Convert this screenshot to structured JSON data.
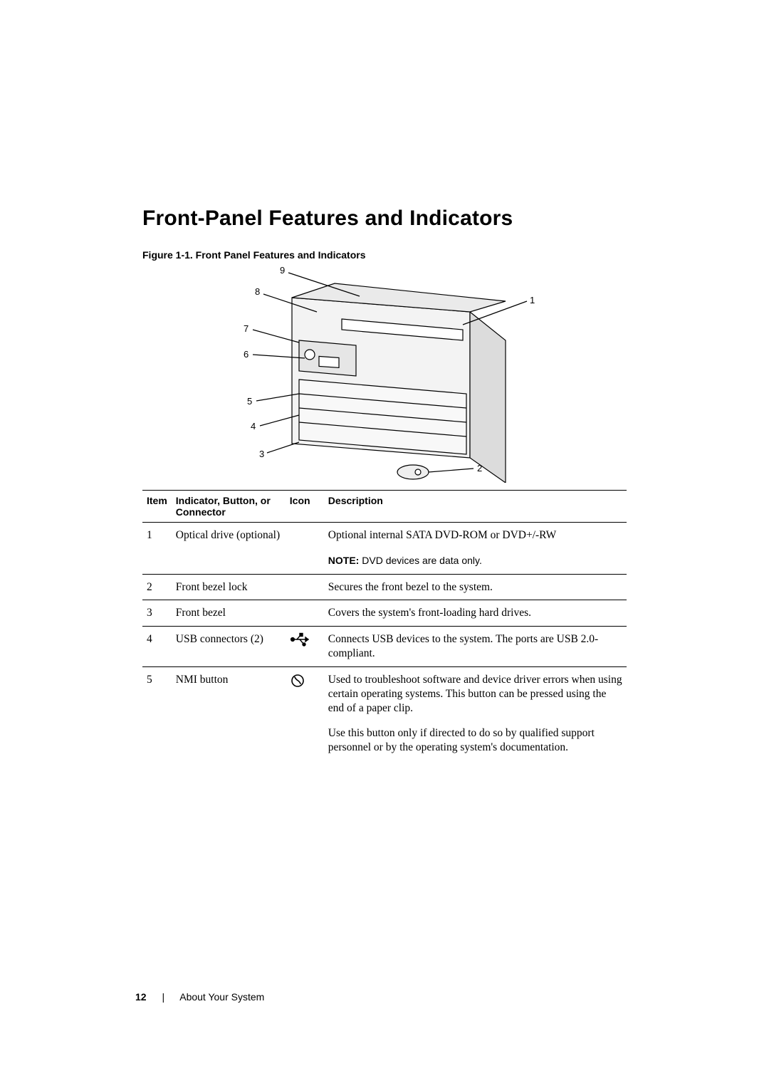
{
  "heading": "Front-Panel Features and Indicators",
  "figure_caption": "Figure 1-1.    Front Panel Features and Indicators",
  "callouts": {
    "l1": "1",
    "l2": "2",
    "l3": "3",
    "l4": "4",
    "l5": "5",
    "l6": "6",
    "l7": "7",
    "l8": "8",
    "l9": "9"
  },
  "table": {
    "headers": {
      "item": "Item",
      "indicator": "Indicator, Button, or Connector",
      "icon": "Icon",
      "description": "Description"
    },
    "rows": [
      {
        "item": "1",
        "indicator": "Optical drive (optional)",
        "icon": "",
        "desc_main": "Optional internal SATA DVD-ROM or DVD+/-RW",
        "note_label": "NOTE:",
        "note_text": " DVD devices are data only."
      },
      {
        "item": "2",
        "indicator": "Front bezel lock",
        "icon": "",
        "desc_main": "Secures the front bezel to the system."
      },
      {
        "item": "3",
        "indicator": "Front bezel",
        "icon": "",
        "desc_main": "Covers the system's front-loading hard drives."
      },
      {
        "item": "4",
        "indicator": "USB connectors (2)",
        "icon": "usb",
        "desc_main": "Connects USB devices to the system. The ports are USB 2.0-compliant."
      },
      {
        "item": "5",
        "indicator": "NMI button",
        "icon": "nmi",
        "desc_main": "Used to troubleshoot software and device driver errors when using certain operating systems. This button can be pressed using the end of a paper clip.",
        "desc_extra": "Use this button only if directed to do so by qualified support personnel or by the operating system's documentation."
      }
    ]
  },
  "footer": {
    "page_number": "12",
    "separator": "|",
    "section": "About Your System"
  }
}
